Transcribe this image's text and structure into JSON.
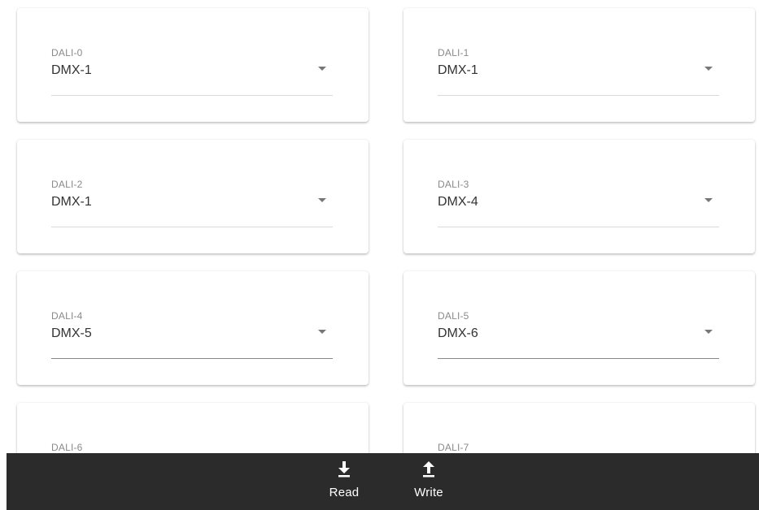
{
  "channels": [
    {
      "label": "DALI-0",
      "value": "DMX-1"
    },
    {
      "label": "DALI-1",
      "value": "DMX-1"
    },
    {
      "label": "DALI-2",
      "value": "DMX-1"
    },
    {
      "label": "DALI-3",
      "value": "DMX-4"
    },
    {
      "label": "DALI-4",
      "value": "DMX-5"
    },
    {
      "label": "DALI-5",
      "value": "DMX-6"
    },
    {
      "label": "DALI-6",
      "value": ""
    },
    {
      "label": "DALI-7",
      "value": ""
    }
  ],
  "actions": {
    "read_label": "Read",
    "write_label": "Write",
    "read_icon": "download-icon",
    "write_icon": "upload-icon"
  },
  "colors": {
    "bar_background": "#2b2b2b",
    "card_background": "#ffffff",
    "label": "#8a8a8a",
    "value": "#333333"
  }
}
